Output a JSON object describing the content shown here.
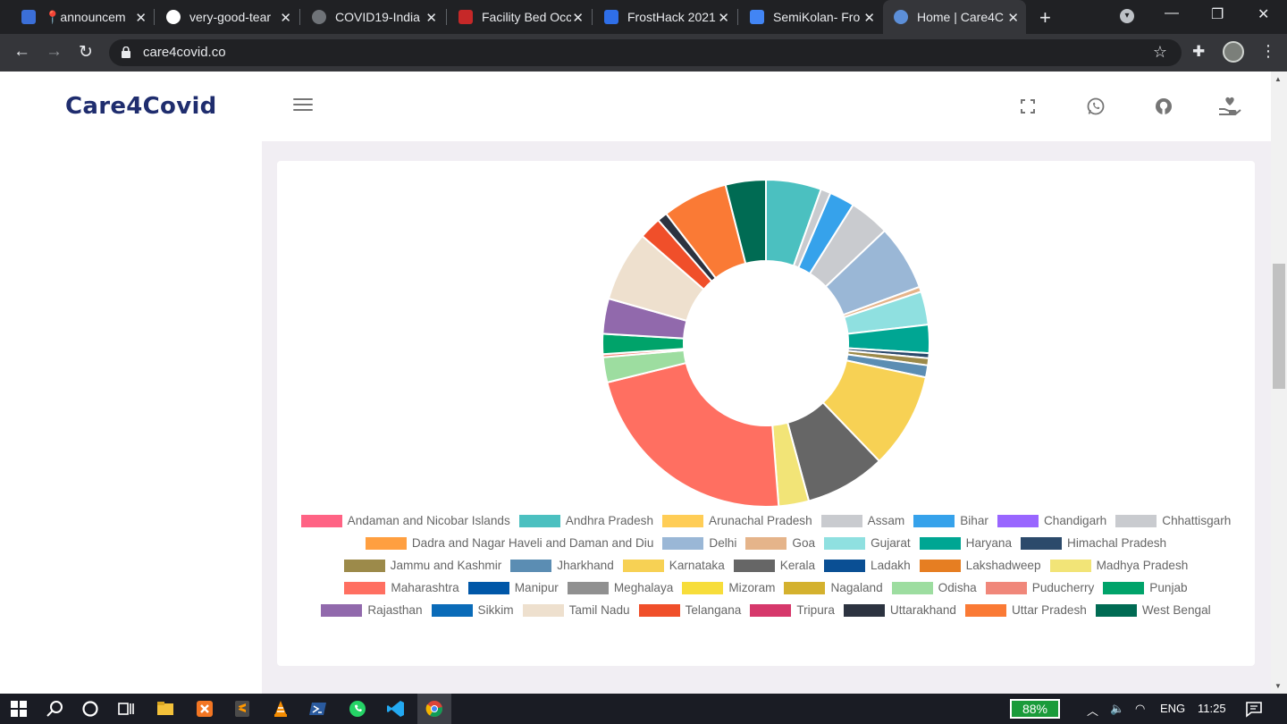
{
  "browser": {
    "tabs": [
      {
        "title": "📍announcem",
        "favicon_color": "#3b6fd8"
      },
      {
        "title": "very-good-tear",
        "favicon_color": "#ffffff"
      },
      {
        "title": "COVID19-India",
        "favicon_color": "#6f7378"
      },
      {
        "title": "Facility Bed Occ",
        "favicon_color": "#c62828"
      },
      {
        "title": "FrostHack 2021",
        "favicon_color": "#2f6fe8"
      },
      {
        "title": "SemiKolan- Fro",
        "favicon_color": "#4285f4"
      },
      {
        "title": "Home | Care4C",
        "favicon_color": "#5c8fd8",
        "active": true
      }
    ],
    "url": "care4covid.co"
  },
  "app": {
    "brand": "Care4Covid",
    "header_icons": [
      "fullscreen-icon",
      "whatsapp-icon",
      "github-icon",
      "donate-hand-icon"
    ]
  },
  "chart_data": {
    "type": "pie",
    "variant": "doughnut",
    "legend_position": "bottom",
    "series": [
      {
        "label": "Andaman and Nicobar Islands",
        "value": 0,
        "color": "#ff6384"
      },
      {
        "label": "Andhra Pradesh",
        "value": 5.5,
        "color": "#4bc0c0"
      },
      {
        "label": "Arunachal Pradesh",
        "value": 0,
        "color": "#ffcd56"
      },
      {
        "label": "Assam",
        "value": 1.0,
        "color": "#c9cbcf"
      },
      {
        "label": "Bihar",
        "value": 2.5,
        "color": "#36a2eb"
      },
      {
        "label": "Chandigarh",
        "value": 0,
        "color": "#9966ff"
      },
      {
        "label": "Chhattisgarh",
        "value": 4.0,
        "color": "#c9cbcf"
      },
      {
        "label": "Dadra and Nagar Haveli and Daman and Diu",
        "value": 0,
        "color": "#ff9f40"
      },
      {
        "label": "Delhi",
        "value": 6.5,
        "color": "#9ab7d6"
      },
      {
        "label": "Goa",
        "value": 0.5,
        "color": "#e5b48a"
      },
      {
        "label": "Gujarat",
        "value": 3.3,
        "color": "#8fe0e0"
      },
      {
        "label": "Haryana",
        "value": 2.8,
        "color": "#00a693"
      },
      {
        "label": "Himachal Pradesh",
        "value": 0.5,
        "color": "#2c4a6b"
      },
      {
        "label": "Jammu and Kashmir",
        "value": 0.7,
        "color": "#9c8a4a"
      },
      {
        "label": "Jharkhand",
        "value": 1.2,
        "color": "#5b8db3"
      },
      {
        "label": "Karnataka",
        "value": 9.5,
        "color": "#f7d154"
      },
      {
        "label": "Kerala",
        "value": 8.0,
        "color": "#666666"
      },
      {
        "label": "Ladakh",
        "value": 0,
        "color": "#0a4f94"
      },
      {
        "label": "Lakshadweep",
        "value": 0,
        "color": "#e67e22"
      },
      {
        "label": "Madhya Pradesh",
        "value": 3.0,
        "color": "#f2e477"
      },
      {
        "label": "Maharashtra",
        "value": 22.5,
        "color": "#ff6f61"
      },
      {
        "label": "Manipur",
        "value": 0,
        "color": "#0057a8"
      },
      {
        "label": "Meghalaya",
        "value": 0,
        "color": "#909090"
      },
      {
        "label": "Mizoram",
        "value": 0,
        "color": "#f7dd3a"
      },
      {
        "label": "Nagaland",
        "value": 0,
        "color": "#d4b12e"
      },
      {
        "label": "Odisha",
        "value": 2.5,
        "color": "#9ddda0"
      },
      {
        "label": "Puducherry",
        "value": 0.3,
        "color": "#f0877a"
      },
      {
        "label": "Punjab",
        "value": 2.0,
        "color": "#00a36a"
      },
      {
        "label": "Rajasthan",
        "value": 3.5,
        "color": "#9169ac"
      },
      {
        "label": "Sikkim",
        "value": 0,
        "color": "#0a6bb8"
      },
      {
        "label": "Tamil Nadu",
        "value": 7.0,
        "color": "#eee0ce"
      },
      {
        "label": "Telangana",
        "value": 2.2,
        "color": "#f04f2a"
      },
      {
        "label": "Tripura",
        "value": 0,
        "color": "#d6386b"
      },
      {
        "label": "Uttarakhand",
        "value": 1.0,
        "color": "#2c3340"
      },
      {
        "label": "Uttar Pradesh",
        "value": 6.5,
        "color": "#fa7a35"
      },
      {
        "label": "West Bengal",
        "value": 4.0,
        "color": "#006b53"
      }
    ]
  },
  "taskbar": {
    "battery": "88%",
    "language": "ENG",
    "time": "11:25"
  }
}
